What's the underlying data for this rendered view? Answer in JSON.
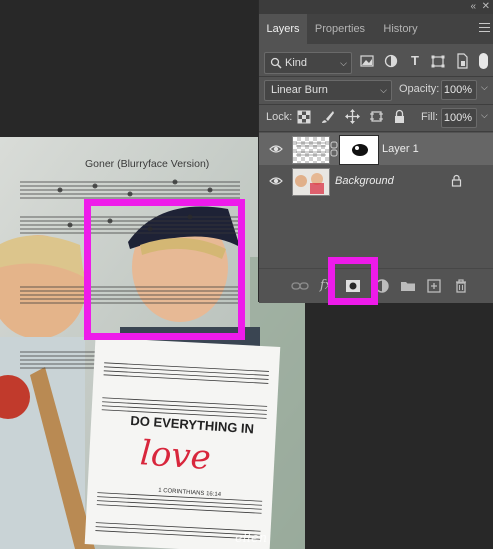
{
  "panel": {
    "tabs": [
      {
        "label": "Layers",
        "active": true
      },
      {
        "label": "Properties",
        "active": false
      },
      {
        "label": "History",
        "active": false
      }
    ],
    "filter": {
      "kind_label": "Kind"
    },
    "blend_mode": "Linear Burn",
    "opacity_label": "Opacity:",
    "opacity_value": "100%",
    "lock_label": "Lock:",
    "fill_label": "Fill:",
    "fill_value": "100%",
    "layers": [
      {
        "name": "Layer 1",
        "selected": true,
        "has_mask": true,
        "locked": false
      },
      {
        "name": "Background",
        "selected": false,
        "has_mask": false,
        "locked": true
      }
    ],
    "bottom_icons": [
      "link-icon",
      "fx-icon",
      "add-mask-icon",
      "adjustment-icon",
      "folder-icon",
      "new-layer-icon",
      "trash-icon"
    ]
  },
  "canvas": {
    "music_title": "Goner (Blurryface Version)",
    "poster_line1": "DO EVERYTHING IN",
    "poster_script": "love",
    "poster_verse": "1 CORINTHIANS 16:14",
    "watermark": "ellen"
  },
  "colors": {
    "highlight": "#ee1bea",
    "panel_bg": "#535353",
    "selected_layer": "#666666",
    "script_red": "#d8263c"
  }
}
